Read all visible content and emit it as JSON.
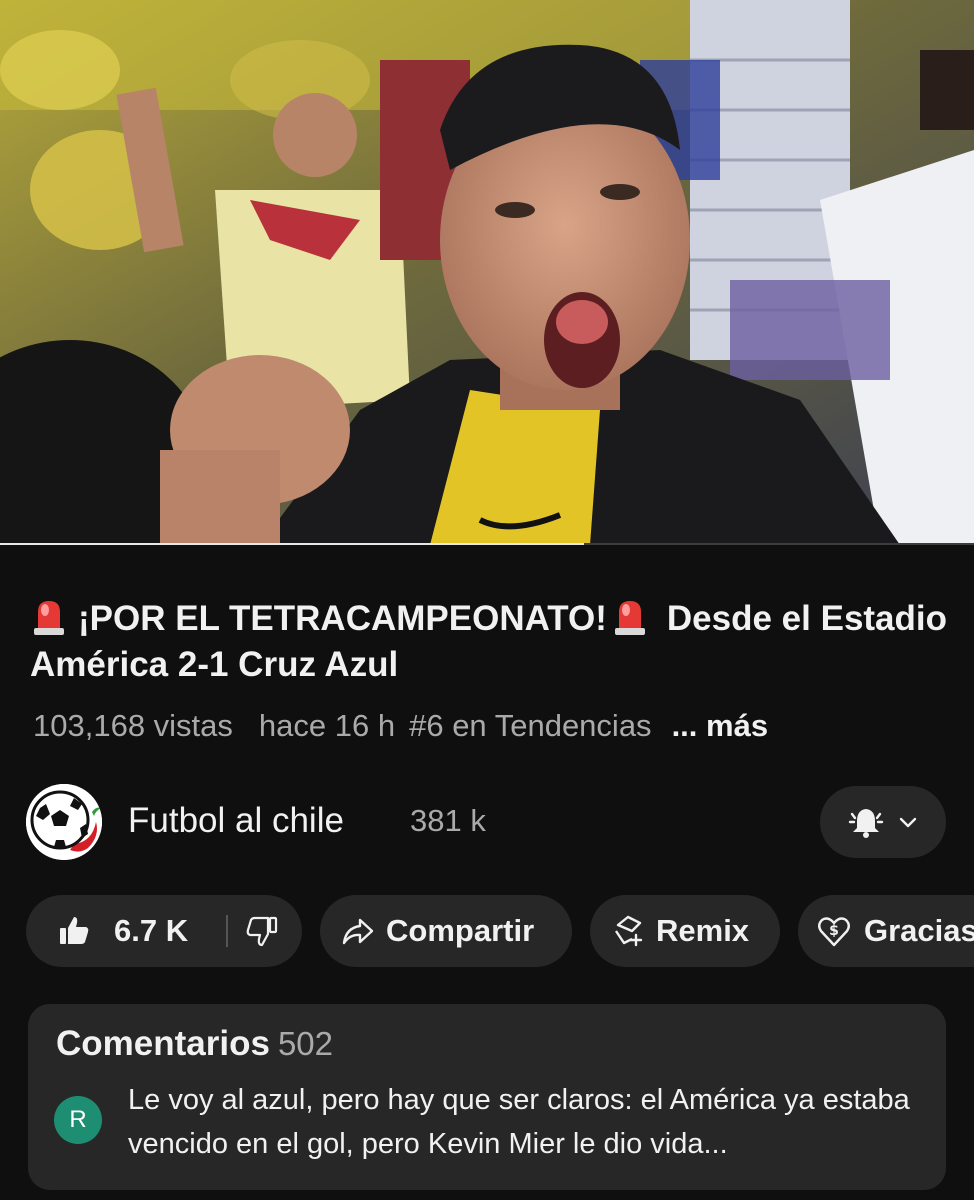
{
  "video": {
    "progress": 0.6
  },
  "title": {
    "part1": "¡POR EL TETRACAMPEONATO!",
    "part2": "Desde el Estadio América 2-1 Cruz Azul",
    "emoji_icon": "siren-icon"
  },
  "meta": {
    "views": "103,168 vistas",
    "time": "hace 16 h",
    "trending": "#6 en Tendencias",
    "more": "... más"
  },
  "channel": {
    "name": "Futbol al chile",
    "subscribers": "381 k",
    "avatar_icon": "soccer-ball-chili-icon",
    "bell_icon": "bell-icon",
    "chevron_icon": "chevron-down-icon"
  },
  "actions": {
    "likes": "6.7 K",
    "share": "Compartir",
    "remix": "Remix",
    "thanks": "Gracias"
  },
  "comments": {
    "title": "Comentarios",
    "count": "502",
    "top_comment": {
      "avatar_letter": "R",
      "text": "Le voy al azul, pero hay que ser claros: el América ya estaba vencido en el gol, pero Kevin Mier le dio vida..."
    }
  },
  "colors": {
    "background": "#0f0f0f",
    "pill": "#272727",
    "muted_text": "#aaaaaa",
    "avatar_green": "#1e8e73"
  }
}
